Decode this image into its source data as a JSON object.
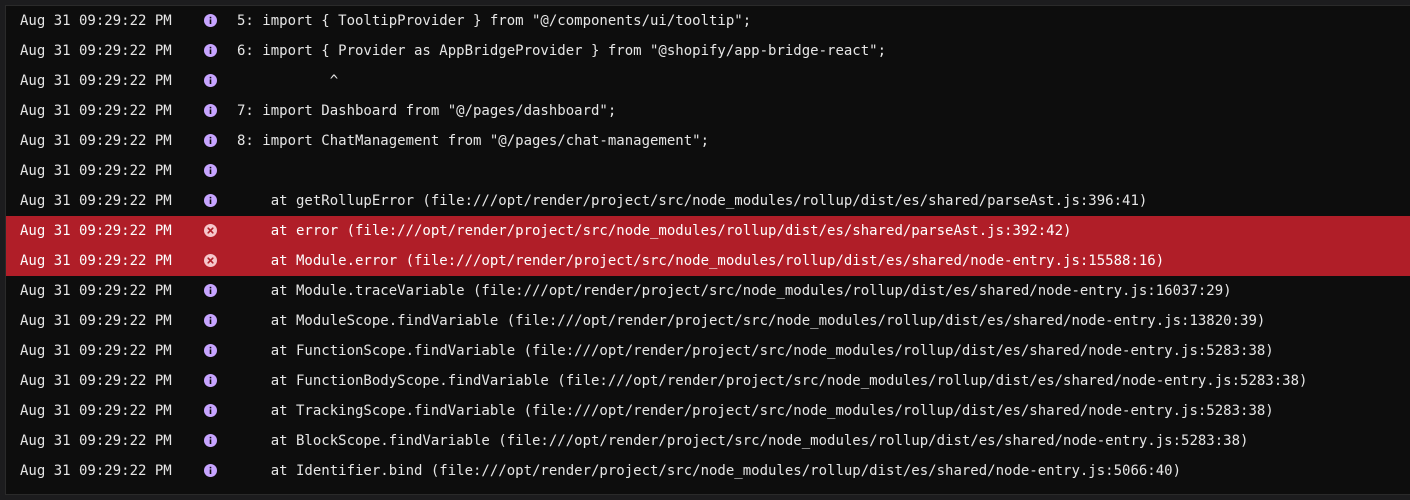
{
  "colors": {
    "panel_bg": "#0d0d0d",
    "error_row_bg": "#b01e28",
    "info_icon": "#c7a4ff",
    "text": "#e6e6e6"
  },
  "logs": [
    {
      "time": "Aug 31 09:29:22 PM",
      "level": "info",
      "level_icon": "info-icon",
      "message": "5: import { TooltipProvider } from \"@/components/ui/tooltip\";"
    },
    {
      "time": "Aug 31 09:29:22 PM",
      "level": "info",
      "level_icon": "info-icon",
      "message": "6: import { Provider as AppBridgeProvider } from \"@shopify/app-bridge-react\";"
    },
    {
      "time": "Aug 31 09:29:22 PM",
      "level": "info",
      "level_icon": "info-icon",
      "message": "           ^"
    },
    {
      "time": "Aug 31 09:29:22 PM",
      "level": "info",
      "level_icon": "info-icon",
      "message": "7: import Dashboard from \"@/pages/dashboard\";"
    },
    {
      "time": "Aug 31 09:29:22 PM",
      "level": "info",
      "level_icon": "info-icon",
      "message": "8: import ChatManagement from \"@/pages/chat-management\";"
    },
    {
      "time": "Aug 31 09:29:22 PM",
      "level": "info",
      "level_icon": "info-icon",
      "message": ""
    },
    {
      "time": "Aug 31 09:29:22 PM",
      "level": "info",
      "level_icon": "info-icon",
      "message": "    at getRollupError (file:///opt/render/project/src/node_modules/rollup/dist/es/shared/parseAst.js:396:41)"
    },
    {
      "time": "Aug 31 09:29:22 PM",
      "level": "error",
      "level_icon": "error-icon",
      "message": "    at error (file:///opt/render/project/src/node_modules/rollup/dist/es/shared/parseAst.js:392:42)"
    },
    {
      "time": "Aug 31 09:29:22 PM",
      "level": "error",
      "level_icon": "error-icon",
      "message": "    at Module.error (file:///opt/render/project/src/node_modules/rollup/dist/es/shared/node-entry.js:15588:16)"
    },
    {
      "time": "Aug 31 09:29:22 PM",
      "level": "info",
      "level_icon": "info-icon",
      "message": "    at Module.traceVariable (file:///opt/render/project/src/node_modules/rollup/dist/es/shared/node-entry.js:16037:29)"
    },
    {
      "time": "Aug 31 09:29:22 PM",
      "level": "info",
      "level_icon": "info-icon",
      "message": "    at ModuleScope.findVariable (file:///opt/render/project/src/node_modules/rollup/dist/es/shared/node-entry.js:13820:39)"
    },
    {
      "time": "Aug 31 09:29:22 PM",
      "level": "info",
      "level_icon": "info-icon",
      "message": "    at FunctionScope.findVariable (file:///opt/render/project/src/node_modules/rollup/dist/es/shared/node-entry.js:5283:38)"
    },
    {
      "time": "Aug 31 09:29:22 PM",
      "level": "info",
      "level_icon": "info-icon",
      "message": "    at FunctionBodyScope.findVariable (file:///opt/render/project/src/node_modules/rollup/dist/es/shared/node-entry.js:5283:38)"
    },
    {
      "time": "Aug 31 09:29:22 PM",
      "level": "info",
      "level_icon": "info-icon",
      "message": "    at TrackingScope.findVariable (file:///opt/render/project/src/node_modules/rollup/dist/es/shared/node-entry.js:5283:38)"
    },
    {
      "time": "Aug 31 09:29:22 PM",
      "level": "info",
      "level_icon": "info-icon",
      "message": "    at BlockScope.findVariable (file:///opt/render/project/src/node_modules/rollup/dist/es/shared/node-entry.js:5283:38)"
    },
    {
      "time": "Aug 31 09:29:22 PM",
      "level": "info",
      "level_icon": "info-icon",
      "message": "    at Identifier.bind (file:///opt/render/project/src/node_modules/rollup/dist/es/shared/node-entry.js:5066:40)"
    }
  ]
}
